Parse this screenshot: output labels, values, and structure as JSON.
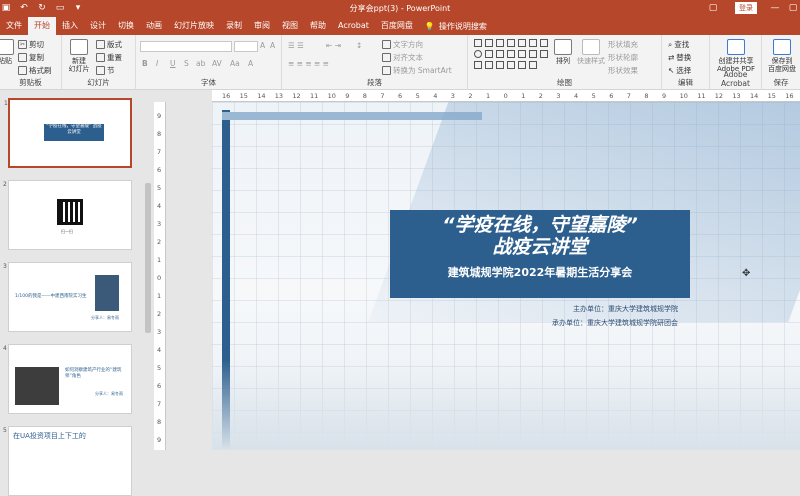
{
  "window": {
    "title": "分享会ppt(3)  -  PowerPoint",
    "login": "登录"
  },
  "tabs": [
    "文件",
    "开始",
    "插入",
    "设计",
    "切换",
    "动画",
    "幻灯片放映",
    "录制",
    "审阅",
    "视图",
    "帮助",
    "Acrobat",
    "百度网盘"
  ],
  "active_tab": "开始",
  "tell_me": "操作说明搜索",
  "ribbon": {
    "clipboard": {
      "label": "剪贴板",
      "paste": "粘贴",
      "cut": "剪切",
      "copy": "复制",
      "format_painter": "格式刷"
    },
    "slides": {
      "label": "幻灯片",
      "new_slide": "新建\n幻灯片",
      "layout": "版式",
      "reset": "重置",
      "section": "节"
    },
    "font": {
      "label": "字体",
      "bold": "B",
      "italic": "I",
      "underline": "U",
      "strike": "S",
      "shadow": "ab",
      "spacing": "AV",
      "case": "Aa",
      "color": "A"
    },
    "paragraph": {
      "label": "段落",
      "text_direction": "文字方向",
      "align_text": "对齐文本",
      "smartart": "转换为 SmartArt"
    },
    "drawing": {
      "label": "绘图",
      "arrange": "排列",
      "quick_styles": "快速样式",
      "shape_fill": "形状填充",
      "shape_outline": "形状轮廓",
      "shape_effects": "形状效果"
    },
    "editing": {
      "label": "编辑",
      "find": "查找",
      "replace": "替换",
      "select": "选择"
    },
    "acrobat": {
      "label": "Adobe Acrobat",
      "create_share": "创建并共享\nAdobe PDF"
    },
    "save": {
      "label": "保存",
      "save_baidu": "保存到\n百度网盘"
    }
  },
  "ruler_h": [
    "16",
    "15",
    "14",
    "13",
    "12",
    "11",
    "10",
    "9",
    "8",
    "7",
    "6",
    "5",
    "4",
    "3",
    "2",
    "1",
    "0",
    "1",
    "2",
    "3",
    "4",
    "5",
    "6",
    "7",
    "8",
    "9",
    "10",
    "11",
    "12",
    "13",
    "14",
    "15",
    "16"
  ],
  "ruler_v": [
    "9",
    "8",
    "7",
    "6",
    "5",
    "4",
    "3",
    "2",
    "1",
    "0",
    "1",
    "2",
    "3",
    "4",
    "5",
    "6",
    "7",
    "8",
    "9"
  ],
  "thumbnails": [
    {
      "num": "1",
      "title": "“学疫在线，守望嘉陵” 战疫云讲堂"
    },
    {
      "num": "2",
      "caption": "扫一扫"
    },
    {
      "num": "3",
      "text": "1/100的我是——中建西南院实习生",
      "author": "分享人：易冬雨"
    },
    {
      "num": "4",
      "text": "如何洞察建筑产行业的“建筑师”角色",
      "author": "分享人：易冬雨"
    },
    {
      "num": "5",
      "text": "在UA投资项目上下工的"
    }
  ],
  "slide": {
    "title_line1": "“学疫在线，守望嘉陵”",
    "title_line2": "战疫云讲堂",
    "subtitle": "建筑城规学院2022年暑期生活分享会",
    "host": "主办单位：重庆大学建筑城规学院",
    "organizer": "承办单位：重庆大学建筑城规学院研团会"
  },
  "colors": {
    "accent": "#b7472a",
    "banner": "#2d5f8e"
  }
}
